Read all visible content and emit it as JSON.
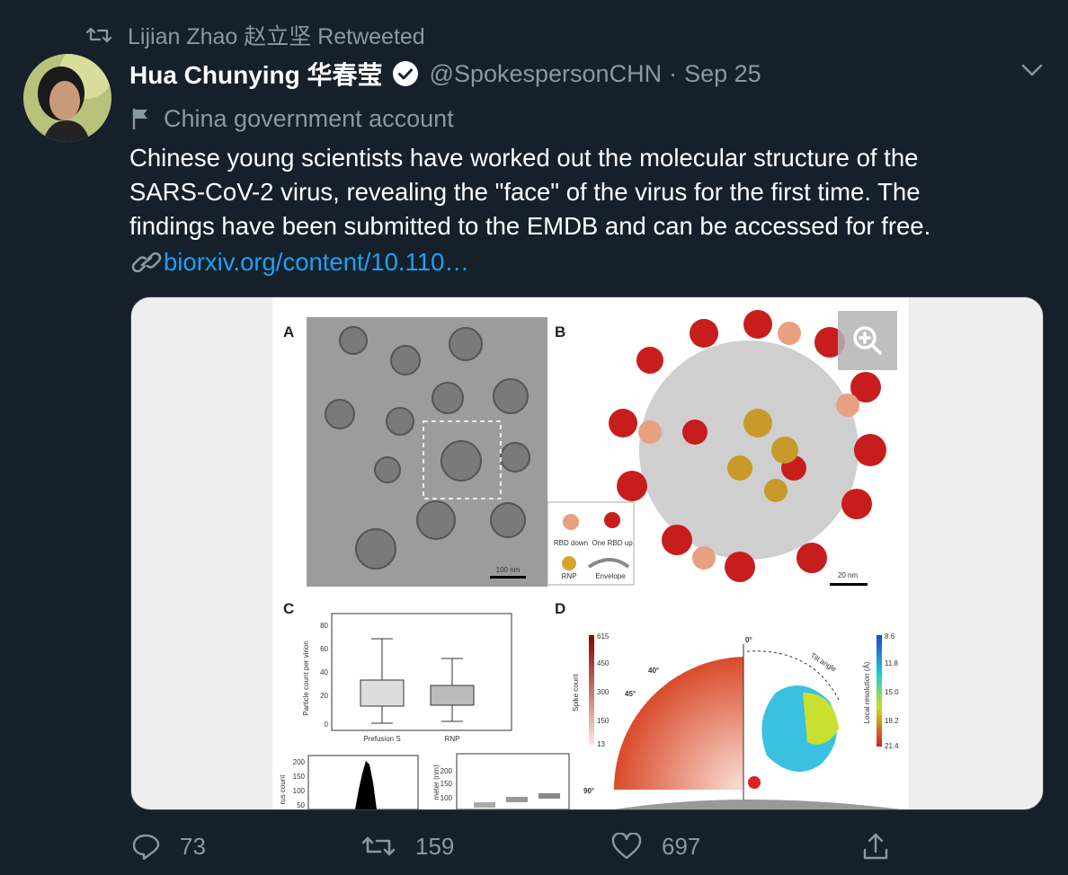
{
  "retweet": {
    "text": "Lijian Zhao 赵立坚 Retweeted"
  },
  "author": {
    "name": "Hua Chunying 华春莹",
    "handle": "@SpokespersonCHN",
    "separator": "·",
    "date": "Sep 25"
  },
  "label": {
    "text": "China government account"
  },
  "tweet": {
    "lines": [
      "Chinese young scientists have worked out the molecular structure of the",
      "SARS-CoV-2 virus, revealing the \"face\" of the virus for the first time. The",
      "findings have been submitted to the EMDB and can be accessed  for free."
    ],
    "link": "biorxiv.org/content/10.110…"
  },
  "figure": {
    "panel_a": "A",
    "panel_b": "B",
    "panel_c": "C",
    "panel_d": "D",
    "scale_a": "100 nm",
    "scale_b": "20 nm",
    "legend": {
      "rbd_down": "RBD down",
      "one_rbd_up": "One RBD up",
      "rnp": "RNP",
      "envelope": "Envelope"
    },
    "boxplot": {
      "ylabel": "Particle count per virion",
      "x1": "Prefusion S",
      "x2": "RNP",
      "ticks": [
        "80",
        "60",
        "40",
        "20",
        "0"
      ]
    },
    "hist": {
      "ylabel": "rus count",
      "ticks": [
        "200",
        "150",
        "100",
        "50"
      ]
    },
    "diam": {
      "ylabel": "meter (nm)",
      "ticks": [
        "200",
        "150",
        "100"
      ]
    },
    "polar": {
      "a0": "0°",
      "a40": "40°",
      "a45": "45°",
      "a90": "90°",
      "tilt": "Tilt angle",
      "scale_label": "Spike count",
      "scale": [
        "615",
        "450",
        "300",
        "150",
        "13"
      ]
    },
    "res": {
      "label": "Local resolution (Å)",
      "scale": [
        "8.6",
        "11.8",
        "15.0",
        "18.2",
        "21.4"
      ]
    }
  },
  "actions": {
    "reply_count": "73",
    "retweet_count": "159",
    "like_count": "697"
  },
  "colors": {
    "background": "#15202b",
    "muted": "#8899a6",
    "link": "#1da1f2"
  }
}
